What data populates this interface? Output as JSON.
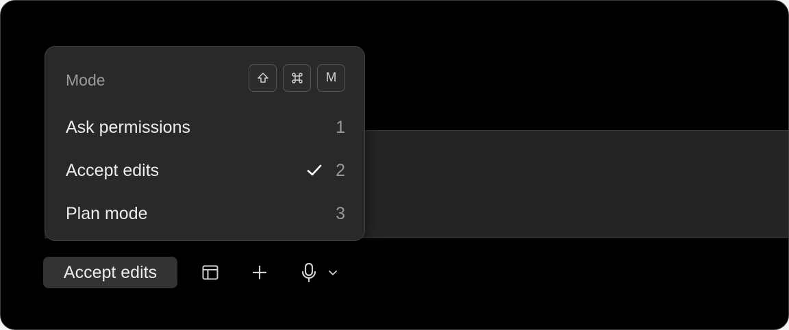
{
  "menu": {
    "title": "Mode",
    "shortcut_keys": [
      {
        "icon": "shift-key-icon"
      },
      {
        "icon": "command-key-icon"
      },
      {
        "label": "M"
      }
    ],
    "items": [
      {
        "label": "Ask permissions",
        "shortcut": "1",
        "selected": false
      },
      {
        "label": "Accept edits",
        "shortcut": "2",
        "selected": true
      },
      {
        "label": "Plan mode",
        "shortcut": "3",
        "selected": false
      }
    ]
  },
  "toolbar": {
    "mode_label": "Accept edits",
    "icons": [
      "panel-layout-icon",
      "plus-icon",
      "microphone-icon",
      "chevron-down-icon"
    ]
  },
  "colors": {
    "background": "#000000",
    "menu_bg": "#292929",
    "text": "#ececec",
    "muted": "#9a9a9a"
  }
}
